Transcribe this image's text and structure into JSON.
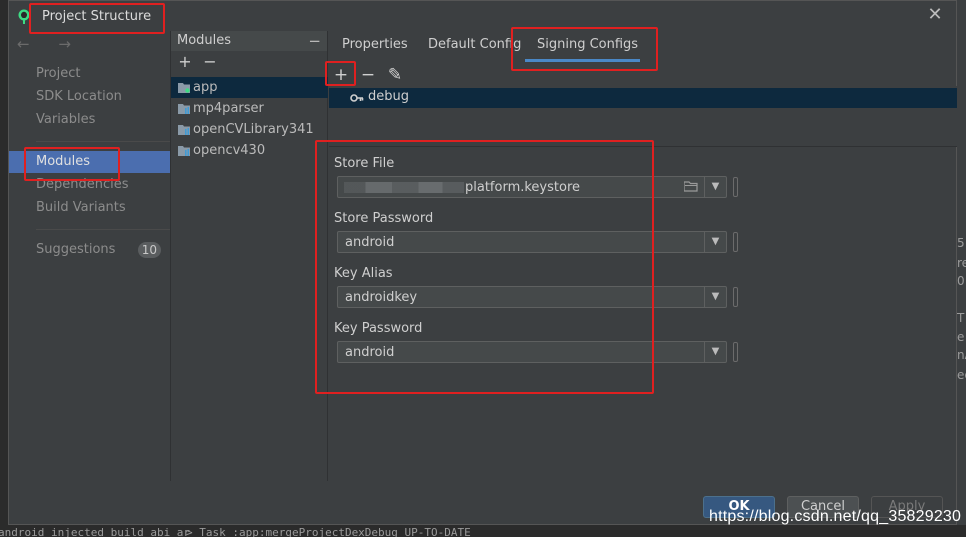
{
  "dialog": {
    "title": "Project Structure",
    "close_glyph": "✕"
  },
  "nav": {
    "arrows": "← →",
    "items": [
      {
        "label": "Project"
      },
      {
        "label": "SDK Location"
      },
      {
        "label": "Variables"
      },
      {
        "label": "Modules",
        "selected": true
      },
      {
        "label": "Dependencies"
      },
      {
        "label": "Build Variants"
      },
      {
        "label": "Suggestions",
        "badge": "10"
      }
    ]
  },
  "modules": {
    "header": "Modules",
    "collapse_glyph": "−",
    "add_glyph": "+",
    "remove_glyph": "−",
    "items": [
      {
        "label": "app",
        "selected": true
      },
      {
        "label": "mp4parser"
      },
      {
        "label": "openCVLibrary341"
      },
      {
        "label": "opencv430"
      }
    ]
  },
  "tabs": [
    {
      "label": "Properties"
    },
    {
      "label": "Default Config"
    },
    {
      "label": "Signing Configs",
      "active": true
    }
  ],
  "toolbar": {
    "add_glyph": "+",
    "remove_glyph": "−",
    "edit_glyph": "✎"
  },
  "signing_configs": [
    {
      "label": "debug",
      "selected": true
    }
  ],
  "form": {
    "store_file": {
      "label": "Store File",
      "value": "platform.keystore"
    },
    "store_password": {
      "label": "Store Password",
      "value": "android"
    },
    "key_alias": {
      "label": "Key Alias",
      "value": "androidkey"
    },
    "key_password": {
      "label": "Key Password",
      "value": "android"
    },
    "dropdown_glyph": "▼"
  },
  "buttons": {
    "ok": "OK",
    "cancel": "Cancel",
    "apply": "Apply"
  },
  "background": {
    "bottom_left_text": "android injected build abi ar",
    "bottom_mid_text": "> Task :app:mergeProjectDexDebug UP-TO-DATE",
    "right_fragments": [
      "5",
      "re",
      "0",
      "T",
      "e",
      "nA",
      "ee"
    ]
  },
  "watermark": "https://blog.csdn.net/qq_35829230",
  "colors": {
    "dialog_bg": "#3c3f41",
    "selection_blue": "#4b6eaf",
    "tree_selection": "#0d293e",
    "tab_underline": "#4a88c7",
    "ok_button": "#365880",
    "highlight_red": "#e02020"
  }
}
